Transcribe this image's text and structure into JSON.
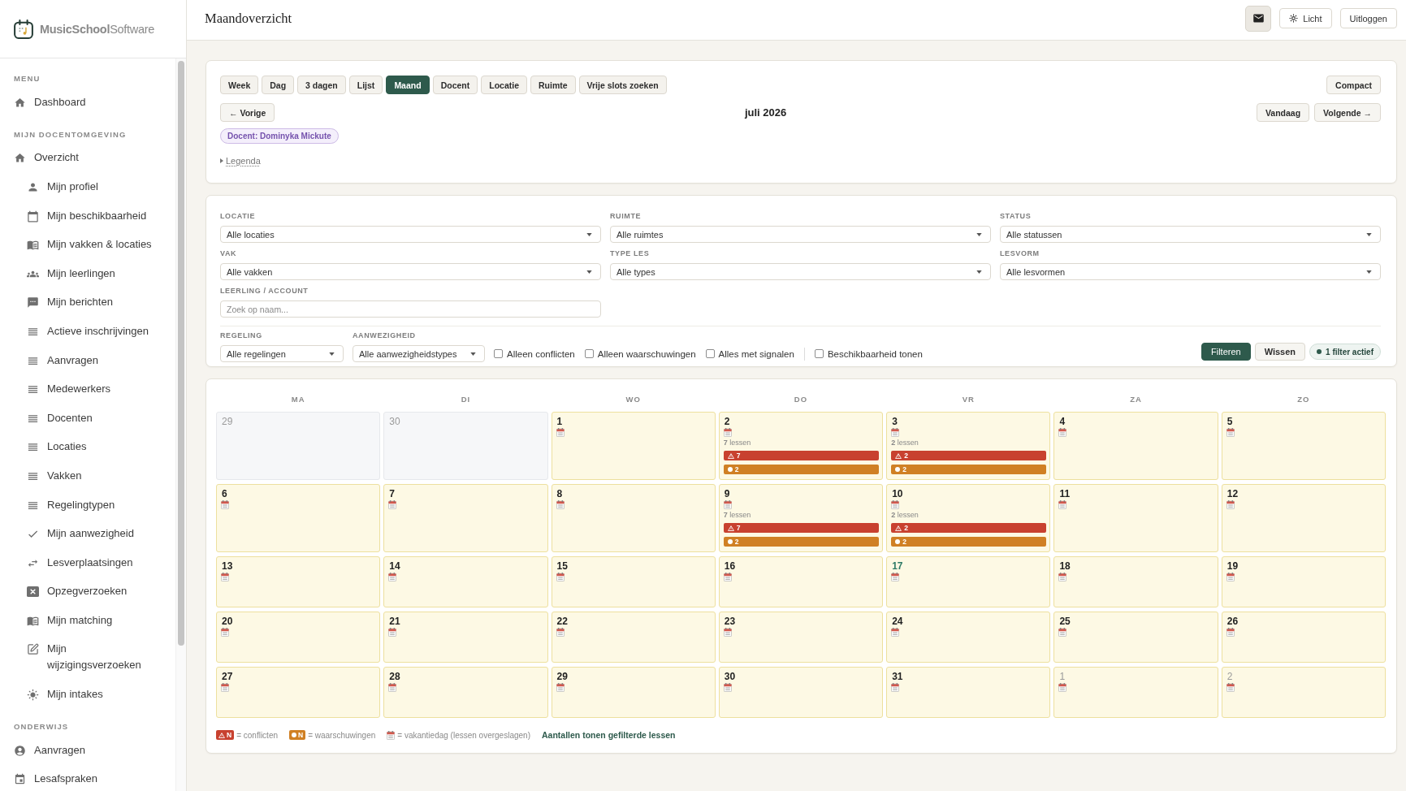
{
  "app": {
    "logo": "**MusicSchool**Software"
  },
  "sidebar": {
    "sections": [
      {
        "heading": "MENU",
        "items": [
          {
            "label": "Dashboard"
          }
        ]
      },
      {
        "heading": "MIJN DOCENTOMGEVING",
        "items": [
          {
            "label": "Overzicht",
            "children": [
              {
                "label": "Mijn profiel"
              },
              {
                "label": "Mijn beschikbaarheid"
              },
              {
                "label": "Mijn vakken & locaties"
              },
              {
                "label": "Mijn leerlingen"
              },
              {
                "label": "Mijn berichten"
              },
              {
                "label": "Actieve inschrijvingen"
              },
              {
                "label": "Aanvragen"
              },
              {
                "label": "Medewerkers"
              },
              {
                "label": "Docenten"
              },
              {
                "label": "Locaties"
              },
              {
                "label": "Vakken"
              },
              {
                "label": "Regelingtypen"
              },
              {
                "label": "Mijn aanwezigheid"
              },
              {
                "label": "Lesverplaatsingen"
              },
              {
                "label": "Opzegverzoeken"
              },
              {
                "label": "Mijn matching"
              },
              {
                "label": "Mijn wijzigingsverzoeken"
              },
              {
                "label": "Mijn intakes"
              }
            ]
          }
        ]
      },
      {
        "heading": "ONDERWIJS",
        "items": [
          {
            "label": "Aanvragen"
          },
          {
            "label": "Lesafspraken"
          }
        ]
      }
    ]
  },
  "header": {
    "title": "Maandoverzicht",
    "buttons": [
      {
        "kind": "mail"
      },
      {
        "kind": "theme",
        "label": "Licht"
      },
      {
        "kind": "text",
        "label": "Uitloggen"
      }
    ]
  },
  "toolbar": {
    "views": [
      {
        "label": "Week",
        "selected": false
      },
      {
        "label": "Dag",
        "selected": false
      },
      {
        "label": "3 dagen",
        "selected": false
      },
      {
        "label": "Lijst",
        "selected": false
      },
      {
        "label": "Maand",
        "selected": true
      },
      {
        "label": "Docent",
        "selected": false
      },
      {
        "label": "Locatie",
        "selected": false
      },
      {
        "label": "Ruimte",
        "selected": false
      },
      {
        "label": "Vrije slots zoeken",
        "selected": false
      }
    ],
    "compact": "Compact",
    "prev": "← Vorige",
    "period": "juli 2026",
    "today": "Vandaag",
    "next": "Volgende →",
    "teacher_chip": "Docent: Dominyka Mickute",
    "legend_toggle": {
      "label": "Legenda",
      "expanded": false
    }
  },
  "filters": {
    "selects": [
      {
        "label": "LOCATIE",
        "value": "Alle locaties"
      },
      {
        "label": "RUIMTE",
        "value": "Alle ruimtes"
      },
      {
        "label": "STATUS",
        "value": "Alle statussen"
      },
      {
        "label": "VAK",
        "value": "Alle vakken"
      },
      {
        "label": "TYPE LES",
        "value": "Alle types"
      },
      {
        "label": "LESVORM",
        "value": "Alle lesvormen"
      }
    ],
    "search": {
      "label": "LEERLING / ACCOUNT",
      "placeholder": "Zoek op naam..."
    },
    "small_selects": [
      {
        "label": "REGELING",
        "value": "Alle regelingen"
      },
      {
        "label": "AANWEZIGHEID",
        "value": "Alle aanwezigheidstypes"
      }
    ],
    "checkbox_groups": [
      [
        {
          "label": "Alleen conflicten",
          "checked": false
        },
        {
          "label": "Alleen waarschuwingen",
          "checked": false
        },
        {
          "label": "Alles met signalen",
          "checked": false
        }
      ],
      [
        {
          "label": "Beschikbaarheid tonen",
          "checked": false
        }
      ]
    ],
    "buttons": [
      {
        "label": "Filteren",
        "kind": "primary"
      },
      {
        "label": "Wissen",
        "kind": "secondary"
      }
    ],
    "active_chip": "1 filter actief"
  },
  "calendar": {
    "weekdays": [
      "MA",
      "DI",
      "WO",
      "DO",
      "VR",
      "ZA",
      "ZO"
    ],
    "weeks": [
      [
        {
          "day": "29",
          "outside": true,
          "holiday": false,
          "today": false
        },
        {
          "day": "30",
          "outside": true,
          "holiday": false,
          "today": false
        },
        {
          "day": "1",
          "outside": false,
          "holiday": true,
          "today": false
        },
        {
          "day": "2",
          "outside": false,
          "holiday": true,
          "today": false,
          "lessons": "**7** lessen",
          "conflicts": "7",
          "warnings": "2"
        },
        {
          "day": "3",
          "outside": false,
          "holiday": true,
          "today": false,
          "lessons": "**2** lessen",
          "conflicts": "2",
          "warnings": "2"
        },
        {
          "day": "4",
          "outside": false,
          "holiday": true,
          "today": false
        },
        {
          "day": "5",
          "outside": false,
          "holiday": true,
          "today": false
        }
      ],
      [
        {
          "day": "6",
          "outside": false,
          "holiday": true,
          "today": false
        },
        {
          "day": "7",
          "outside": false,
          "holiday": true,
          "today": false
        },
        {
          "day": "8",
          "outside": false,
          "holiday": true,
          "today": false
        },
        {
          "day": "9",
          "outside": false,
          "holiday": true,
          "today": false,
          "lessons": "**7** lessen",
          "conflicts": "7",
          "warnings": "2"
        },
        {
          "day": "10",
          "outside": false,
          "holiday": true,
          "today": false,
          "lessons": "**2** lessen",
          "conflicts": "2",
          "warnings": "2"
        },
        {
          "day": "11",
          "outside": false,
          "holiday": true,
          "today": false
        },
        {
          "day": "12",
          "outside": false,
          "holiday": true,
          "today": false
        }
      ],
      [
        {
          "day": "13",
          "outside": false,
          "holiday": true,
          "today": false
        },
        {
          "day": "14",
          "outside": false,
          "holiday": true,
          "today": false
        },
        {
          "day": "15",
          "outside": false,
          "holiday": true,
          "today": false
        },
        {
          "day": "16",
          "outside": false,
          "holiday": true,
          "today": false
        },
        {
          "day": "17",
          "outside": false,
          "holiday": true,
          "today": true
        },
        {
          "day": "18",
          "outside": false,
          "holiday": true,
          "today": false
        },
        {
          "day": "19",
          "outside": false,
          "holiday": true,
          "today": false
        }
      ],
      [
        {
          "day": "20",
          "outside": false,
          "holiday": true,
          "today": false
        },
        {
          "day": "21",
          "outside": false,
          "holiday": true,
          "today": false
        },
        {
          "day": "22",
          "outside": false,
          "holiday": true,
          "today": false
        },
        {
          "day": "23",
          "outside": false,
          "holiday": true,
          "today": false
        },
        {
          "day": "24",
          "outside": false,
          "holiday": true,
          "today": false
        },
        {
          "day": "25",
          "outside": false,
          "holiday": true,
          "today": false
        },
        {
          "day": "26",
          "outside": false,
          "holiday": true,
          "today": false
        }
      ],
      [
        {
          "day": "27",
          "outside": false,
          "holiday": true,
          "today": false
        },
        {
          "day": "28",
          "outside": false,
          "holiday": true,
          "today": false
        },
        {
          "day": "29",
          "outside": false,
          "holiday": true,
          "today": false
        },
        {
          "day": "30",
          "outside": false,
          "holiday": true,
          "today": false
        },
        {
          "day": "31",
          "outside": false,
          "holiday": true,
          "today": false
        },
        {
          "day": "1",
          "outside": true,
          "holiday": true,
          "today": false
        },
        {
          "day": "2",
          "outside": true,
          "holiday": true,
          "today": false
        }
      ]
    ],
    "legend": {
      "items": [
        {
          "kind": "conflict",
          "badge": "N",
          "text": "= conflicten"
        },
        {
          "kind": "warning",
          "badge": "N",
          "text": "= waarschuwingen"
        },
        {
          "kind": "holiday",
          "text": "= vakantiedag (lessen overgeslagen)"
        }
      ],
      "note": "Aantallen tonen gefilterde lessen"
    }
  }
}
